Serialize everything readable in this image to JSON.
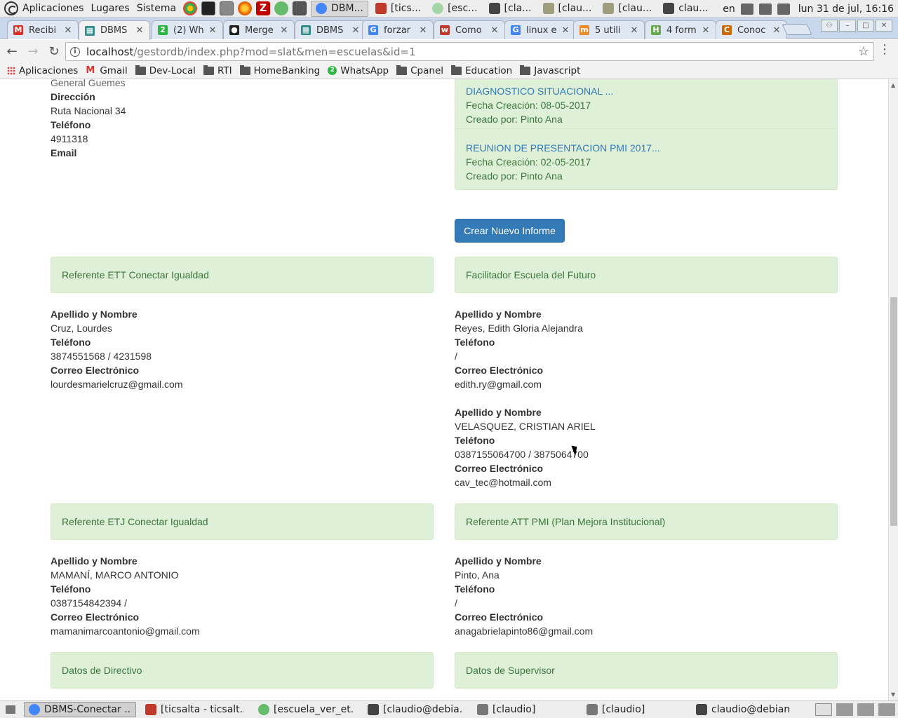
{
  "os_panel": {
    "menus": [
      "Aplicaciones",
      "Lugares",
      "Sistema"
    ],
    "launcher_icons": [
      "chrome-icon",
      "terminal-icon",
      "calculator-icon",
      "firefox-icon",
      "filezilla-icon",
      "atom-icon",
      "screenshot-icon"
    ],
    "tasks": [
      {
        "label": "DBM...",
        "icon": "chrome-icon",
        "active": true
      },
      {
        "label": "[tics...",
        "icon": "filezilla-icon",
        "active": false
      },
      {
        "label": "[esc...",
        "icon": "atom-icon",
        "active": false
      },
      {
        "label": "[cla...",
        "icon": "terminal-icon",
        "active": false
      },
      {
        "label": "[clau...",
        "icon": "folder-icon",
        "active": false
      },
      {
        "label": "[clau...",
        "icon": "folder-icon",
        "active": false
      },
      {
        "label": "clau...",
        "icon": "terminal-icon",
        "active": false
      }
    ],
    "keyboard_layout": "en",
    "clock": "lun 31 de jul, 16:16"
  },
  "tabs": [
    {
      "label": "Recibi",
      "favicon": "gmail-icon",
      "color": "#d93025",
      "glyph": "M"
    },
    {
      "label": "DBMS",
      "favicon": "dbms-icon",
      "color": "#2a8a8a",
      "glyph": "▦",
      "active": true
    },
    {
      "label": "(2) Wh",
      "favicon": "whatsapp-icon",
      "color": "#2db742",
      "glyph": "2"
    },
    {
      "label": "Merge",
      "favicon": "github-icon",
      "color": "#222222",
      "glyph": "●"
    },
    {
      "label": "DBMS",
      "favicon": "dbms-icon",
      "color": "#2a8a8a",
      "glyph": "▦"
    },
    {
      "label": "forzar",
      "favicon": "google-icon",
      "color": "#4285f4",
      "glyph": "G"
    },
    {
      "label": "Como",
      "favicon": "w-icon",
      "color": "#c0392b",
      "glyph": "w"
    },
    {
      "label": "linux e",
      "favicon": "google-icon",
      "color": "#4285f4",
      "glyph": "G"
    },
    {
      "label": "5 utili",
      "favicon": "m-icon",
      "color": "#f08a24",
      "glyph": "m"
    },
    {
      "label": "4 form",
      "favicon": "h-icon",
      "color": "#6aa84f",
      "glyph": "H"
    },
    {
      "label": "Conoc",
      "favicon": "c-icon",
      "color": "#cc6a00",
      "glyph": "C"
    }
  ],
  "toolbar": {
    "back": "←",
    "forward": "→",
    "reload": "↻",
    "url_host": "localhost",
    "url_path": "/gestordb/index.php?mod=slat&men=escuelas&id=1",
    "star": "☆",
    "menu": "⋮"
  },
  "bookmarks": [
    {
      "label": "Aplicaciones",
      "icon": "apps"
    },
    {
      "label": "Gmail",
      "icon": "gmail"
    },
    {
      "label": "Dev-Local",
      "icon": "folder"
    },
    {
      "label": "RTI",
      "icon": "folder"
    },
    {
      "label": "HomeBanking",
      "icon": "folder"
    },
    {
      "label": "WhatsApp",
      "icon": "wa"
    },
    {
      "label": "Cpanel",
      "icon": "folder"
    },
    {
      "label": "Education",
      "icon": "folder"
    },
    {
      "label": "Javascript",
      "icon": "folder"
    }
  ],
  "school": {
    "localidad": "General Guemes",
    "direccion_label": "Dirección",
    "direccion": "Ruta Nacional 34",
    "telefono_label": "Teléfono",
    "telefono": "4911318",
    "email_label": "Email"
  },
  "reports": [
    {
      "title": "DIAGNOSTICO SITUACIONAL ...",
      "fecha": "Fecha Creación: 08-05-2017",
      "creado": "Creado por: Pinto Ana"
    },
    {
      "title": "REUNION DE PRESENTACION PMI 2017...",
      "fecha": "Fecha Creación: 02-05-2017",
      "creado": "Creado por: Pinto Ana"
    }
  ],
  "crear_informe": "Crear Nuevo Informe",
  "labels": {
    "nombre": "Apellido y Nombre",
    "telefono": "Teléfono",
    "correo": "Correo Electrónico"
  },
  "sections": {
    "ett": {
      "title": "Referente ETT Conectar Igualdad",
      "people": [
        {
          "nombre": "Cruz, Lourdes",
          "telefono": "3874551568 / 4231598",
          "correo": "lourdesmarielcruz@gmail.com"
        }
      ]
    },
    "facilitador": {
      "title": "Facilitador Escuela del Futuro",
      "people": [
        {
          "nombre": "Reyes, Edith Gloria Alejandra",
          "telefono": "/",
          "correo": "edith.ry@gmail.com"
        },
        {
          "nombre": "VELASQUEZ, CRISTIAN ARIEL",
          "telefono": "0387155064700 / 3875064700",
          "correo": "cav_tec@hotmail.com"
        }
      ]
    },
    "etj": {
      "title": "Referente ETJ Conectar Igualdad",
      "people": [
        {
          "nombre": "MAMANÍ, MARCO ANTONIO",
          "telefono": "0387154842394 /",
          "correo": "mamanimarcoantonio@gmail.com"
        }
      ]
    },
    "att": {
      "title": "Referente ATT PMI (Plan Mejora Institucional)",
      "people": [
        {
          "nombre": "Pinto, Ana",
          "telefono": "/",
          "correo": "anagabrielapinto86@gmail.com"
        }
      ]
    },
    "directivo": {
      "title": "Datos de Directivo"
    },
    "supervisor": {
      "title": "Datos de Supervisor"
    }
  },
  "taskbar": [
    {
      "label": "DBMS-Conectar ...",
      "icon": "chrome-icon",
      "color": "#4285f4",
      "active": true
    },
    {
      "label": "[ticsalta - ticsalt...",
      "icon": "filezilla-icon",
      "color": "#c0392b"
    },
    {
      "label": "[escuela_ver_et...",
      "icon": "atom-icon",
      "color": "#66bb6a"
    },
    {
      "label": "[claudio@debia...",
      "icon": "terminal-icon",
      "color": "#444444"
    },
    {
      "label": "[claudio]",
      "icon": "folder-icon",
      "color": "#777777"
    },
    {
      "label": "[claudio]",
      "icon": "folder-icon",
      "color": "#777777"
    },
    {
      "label": "claudio@debian...",
      "icon": "terminal-icon",
      "color": "#444444"
    }
  ]
}
